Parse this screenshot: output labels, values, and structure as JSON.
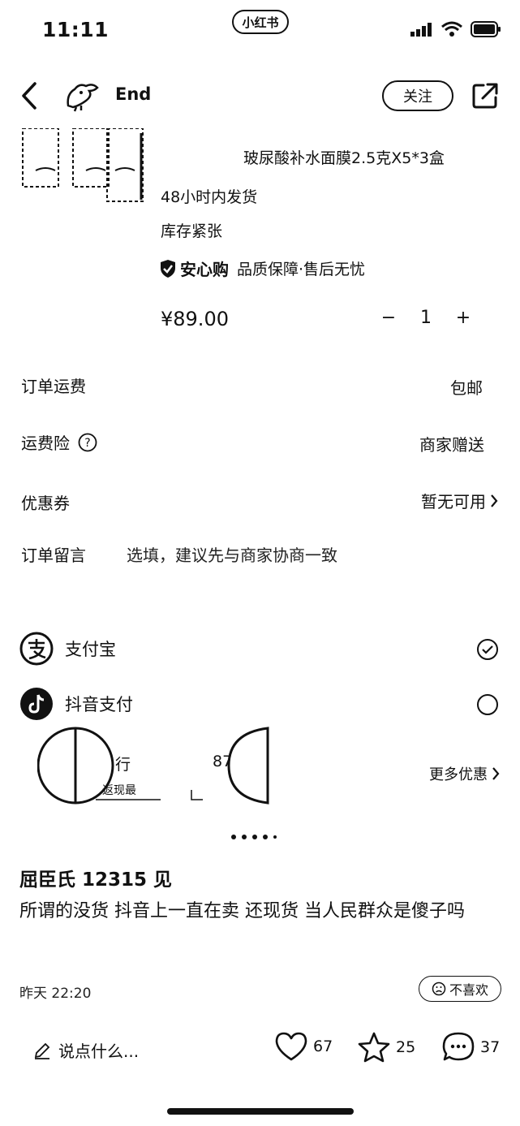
{
  "status_bar": {
    "time": "11:11",
    "app_label": "小红书"
  },
  "header": {
    "shop_name": "End",
    "follow_label": "关注"
  },
  "product": {
    "title": "玻尿酸补水面膜2.5克X5*3盒",
    "shipping": "48小时内发货",
    "stock": "库存紧张",
    "guarantee_brand": "安心购",
    "guarantee_text": "品质保障·售后无忧",
    "price": "¥89.00",
    "quantity": "1",
    "minus": "−",
    "plus": "+"
  },
  "order": {
    "shipping_fee_label": "订单运费",
    "shipping_fee_value": "包邮",
    "insurance_label": "运费险",
    "insurance_value": "商家赠送",
    "coupon_label": "优惠券",
    "coupon_value": "暂无可用",
    "note_label": "订单留言",
    "note_placeholder": "选填，建议先与商家协商一致"
  },
  "payment": {
    "alipay_label": "支付宝",
    "douyin_label": "抖音支付",
    "bank_label": "行",
    "bank_amount": "87",
    "bank_sub": "返现最",
    "more_offers": "更多优惠"
  },
  "comment": {
    "user": "屈臣氏 12315 见",
    "text": "所谓的没货 抖音上一直在卖 还现货 当人民群众是傻子吗",
    "time": "昨天 22:20",
    "dislike": "不喜欢"
  },
  "bottom_bar": {
    "placeholder": "说点什么...",
    "likes": "67",
    "favorites": "25",
    "comments": "37"
  }
}
